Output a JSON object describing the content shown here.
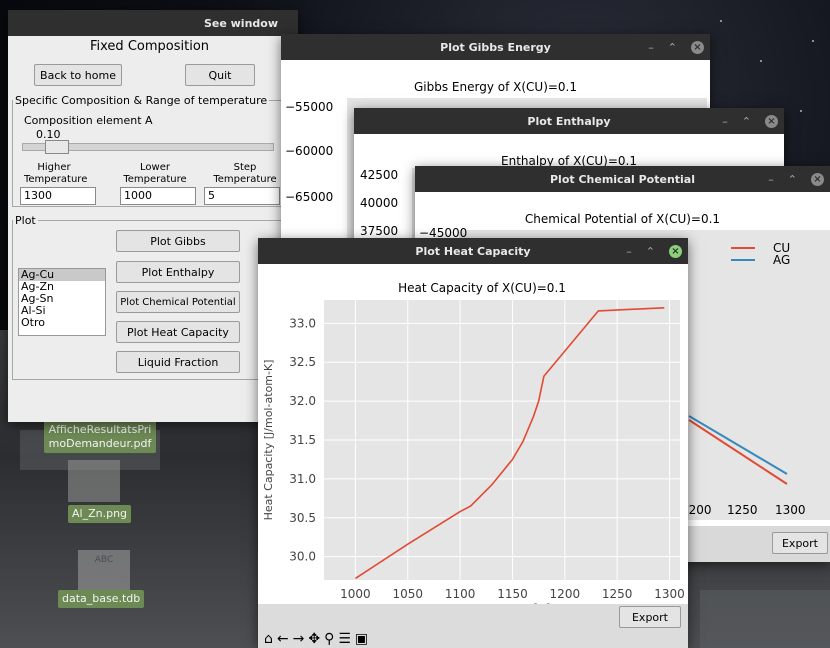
{
  "desktop": {
    "files": [
      {
        "name": "AfficheResultatsPri\nmoDemandeur.pdf"
      },
      {
        "name": "Al_Zn.png"
      },
      {
        "name": "data_base.tdb",
        "icon_text": "ABC"
      }
    ]
  },
  "see_window": {
    "title": "See window",
    "heading": "Fixed Composition",
    "back_label": "Back to home",
    "quit_label": "Quit",
    "group_title": "Specific Composition & Range of temperature",
    "composition_label": "Composition element A",
    "composition_value": "0.10",
    "slider_value": 0.1,
    "higher_label": "Higher\nTemperature",
    "lower_label": "Lower\nTemperature",
    "step_label": "Step\nTemperature",
    "higher_value": "1300",
    "lower_value": "1000",
    "step_value": "5",
    "plot_group_title": "Plot",
    "systems": [
      "Ag-Cu",
      "Ag-Zn",
      "Ag-Sn",
      "Al-Si",
      "Otro"
    ],
    "selected_system": "Ag-Cu",
    "buttons": {
      "gibbs": "Plot Gibbs",
      "enthalpy": "Plot Enthalpy",
      "chem": "Plot Chemical Potential",
      "heat": "Plot Heat Capacity",
      "liquid": "Liquid Fraction"
    }
  },
  "gibbs_window": {
    "title": "Plot Gibbs Energy",
    "chart_title": "Gibbs Energy of X(CU)=0.1",
    "y_ticks": [
      "−55000",
      "−60000",
      "−65000"
    ]
  },
  "enthalpy_window": {
    "title": "Plot Enthalpy",
    "chart_title": "Enthalpy of X(CU)=0.1",
    "y_ticks": [
      "42500",
      "40000",
      "37500"
    ]
  },
  "chem_window": {
    "title": "Plot Chemical Potential",
    "chart_title": "Chemical Potential of X(CU)=0.1",
    "y_tick": "−45000",
    "legend": [
      "CU",
      "AG"
    ],
    "x_ticks": [
      "1200",
      "1250",
      "1300"
    ],
    "export_label": "Export",
    "colors": {
      "cu": "#e24a33",
      "ag": "#348abd"
    }
  },
  "heat_window": {
    "title": "Plot Heat Capacity",
    "export_label": "Export",
    "toolbar_icons": [
      "home-icon",
      "back-arrow-icon",
      "forward-arrow-icon",
      "pan-icon",
      "zoom-icon",
      "configure-subplots-icon",
      "save-icon"
    ]
  },
  "chart_data": {
    "type": "line",
    "title": "Heat Capacity of X(CU)=0.1",
    "xlabel": "Temperature [K]",
    "ylabel": "Heat Capacity [J/mol-atom-K]",
    "xlim": [
      970,
      1310
    ],
    "ylim": [
      29.7,
      33.3
    ],
    "x_ticks": [
      1000,
      1050,
      1100,
      1150,
      1200,
      1250,
      1300
    ],
    "y_ticks": [
      30.0,
      30.5,
      31.0,
      31.5,
      32.0,
      32.5,
      33.0
    ],
    "grid": true,
    "line_color": "#e24a33",
    "x": [
      1000,
      1050,
      1100,
      1110,
      1130,
      1150,
      1160,
      1170,
      1175,
      1180,
      1232,
      1295
    ],
    "y": [
      29.72,
      30.16,
      30.58,
      30.65,
      30.92,
      31.25,
      31.48,
      31.8,
      32.0,
      32.32,
      33.16,
      33.2
    ]
  }
}
